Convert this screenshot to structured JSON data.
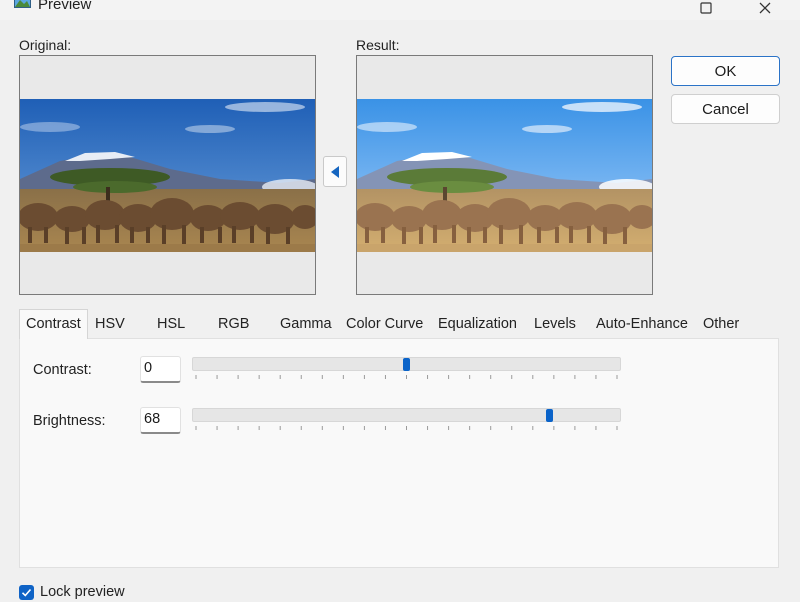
{
  "window": {
    "title": "Preview",
    "icon": "picture-icon",
    "controls": [
      "maximize-icon",
      "close-icon"
    ]
  },
  "panes": {
    "original_label": "Original:",
    "result_label": "Result:",
    "copy_arrow_icon": "triangle-left-icon"
  },
  "buttons": {
    "ok": "OK",
    "cancel": "Cancel"
  },
  "tabs": [
    {
      "label": "Contrast",
      "active": true
    },
    {
      "label": "HSV"
    },
    {
      "label": "HSL"
    },
    {
      "label": "RGB"
    },
    {
      "label": "Gamma"
    },
    {
      "label": "Color Curve"
    },
    {
      "label": "Equalization"
    },
    {
      "label": "Levels"
    },
    {
      "label": "Auto-Enhance"
    },
    {
      "label": "Other"
    }
  ],
  "contrast": {
    "label": "Contrast:",
    "value": "0",
    "slider_fraction": 0.5
  },
  "brightness": {
    "label": "Brightness:",
    "value": "68",
    "slider_fraction": 0.84
  },
  "lock_preview": {
    "label": "Lock preview",
    "checked": true
  },
  "colors": {
    "accent": "#0a63c9",
    "checkbox": "#0f63c6"
  }
}
